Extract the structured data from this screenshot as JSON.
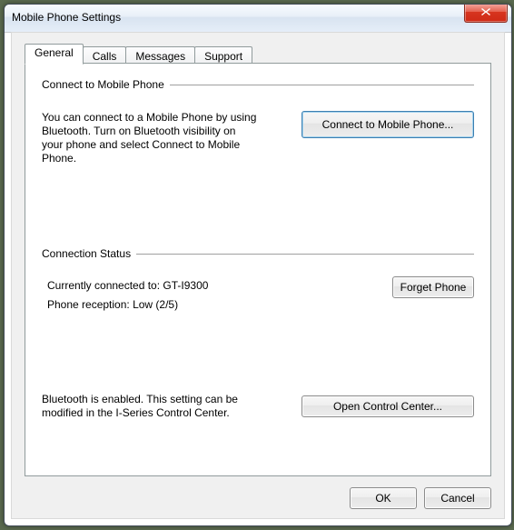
{
  "window": {
    "title": "Mobile Phone Settings"
  },
  "tabs": {
    "general": "General",
    "calls": "Calls",
    "messages": "Messages",
    "support": "Support"
  },
  "section_connect": {
    "header": "Connect to Mobile Phone",
    "description": "You can connect to a Mobile Phone by using Bluetooth. Turn on Bluetooth visibility on your phone and select Connect to Mobile Phone.",
    "button": "Connect to Mobile Phone..."
  },
  "section_status": {
    "header": "Connection Status",
    "line1": "Currently connected to: GT-I9300",
    "line2": "Phone reception: Low (2/5)",
    "forget_button": "Forget Phone"
  },
  "section_bt": {
    "description": "Bluetooth is enabled. This setting can be modified in the I-Series Control Center.",
    "button": "Open Control Center..."
  },
  "dialog": {
    "ok": "OK",
    "cancel": "Cancel"
  }
}
